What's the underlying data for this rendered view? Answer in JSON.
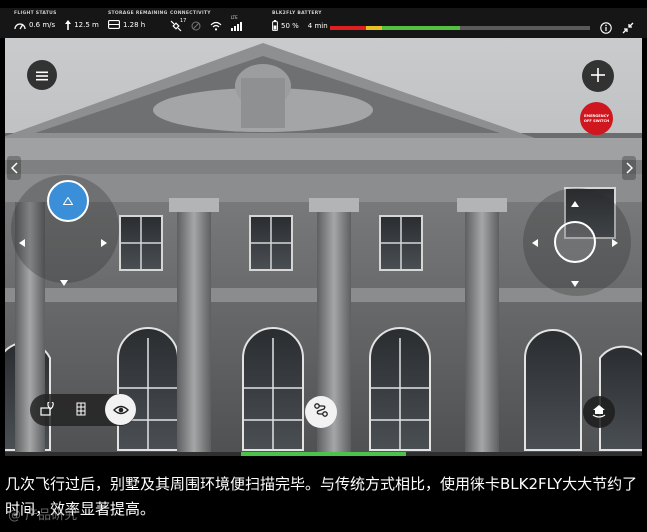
{
  "status_bar": {
    "flight_status": {
      "label": "FLIGHT STATUS",
      "speed": "0.6 m/s",
      "altitude": "12.5 m",
      "icons": [
        "speedometer-icon",
        "altitude-arrow-icon"
      ]
    },
    "storage": {
      "label": "STORAGE REMAINING",
      "value": "1.28 h",
      "icon": "storage-icon"
    },
    "connectivity": {
      "label": "CONNECTIVITY",
      "satellites": "17",
      "icons": [
        "satellite-icon",
        "disabled-icon",
        "wifi-icon",
        "lte-signal-icon"
      ],
      "lte_label": "LTE"
    },
    "battery": {
      "label": "BLK2FLY BATTERY",
      "percent": "50 %",
      "time": "4 min",
      "level": 0.5,
      "bar_colors": [
        "#e02020",
        "#e8c020",
        "#55c040",
        "#5a5a5a"
      ]
    },
    "buttons": [
      "info-icon",
      "collapse-icon"
    ]
  },
  "scan_progress": {
    "fill": 0.26,
    "color": "#4cc24c"
  },
  "controls": {
    "menu": "hamburger-icon",
    "add": "plus-icon",
    "emergency": {
      "line1": "EMERGENCY",
      "line2": "OFF SWITCH",
      "color": "#d0161e"
    },
    "left_stick_color": "#3b8fd9",
    "toolbar": [
      "map-pin-icon",
      "grid-scan-icon",
      "eye-icon"
    ],
    "route": "route-icon",
    "home": "return-home-icon"
  },
  "caption": {
    "text": "几次飞行过后，别墅及其周围环境便扫描完毕。与传统方式相比，使用徕卡BLK2FLY大大节约了时间，效率显著提高。"
  },
  "watermark": "@ 产品研究"
}
